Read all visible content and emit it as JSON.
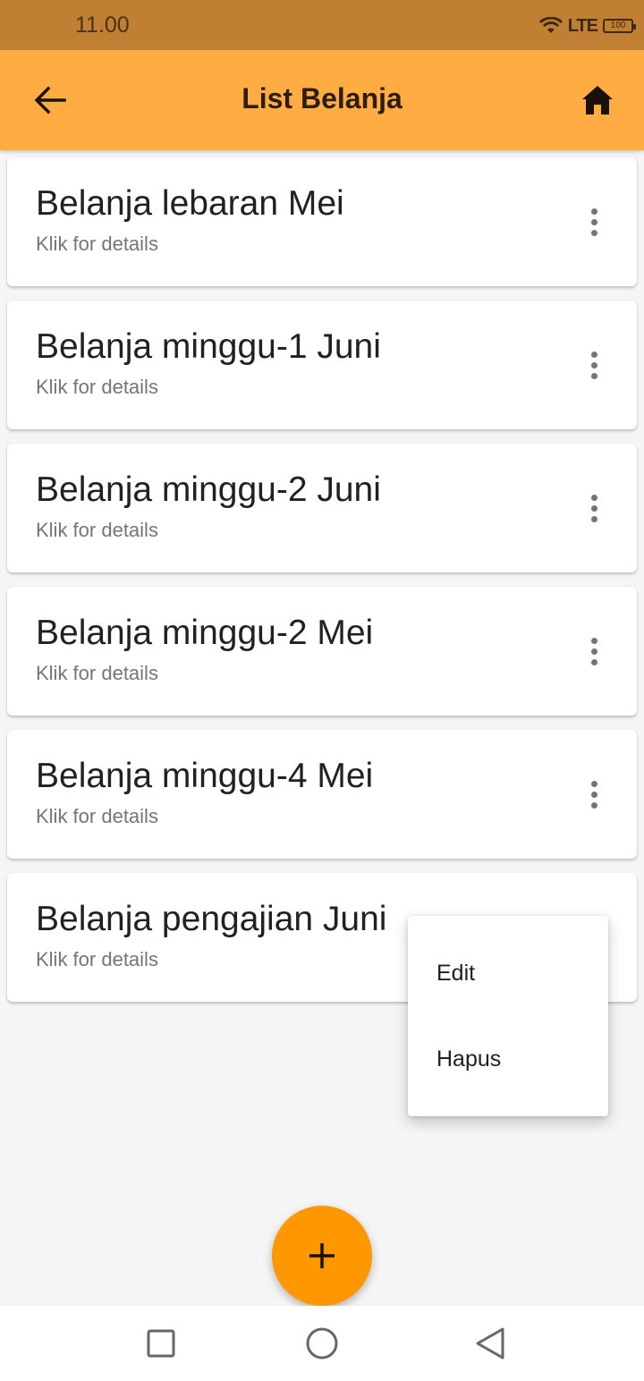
{
  "status_bar": {
    "time": "11.00",
    "network": "LTE",
    "battery": "100",
    "icons": [
      "wifi-icon",
      "lte-icon",
      "battery-icon"
    ]
  },
  "app_bar": {
    "title": "List Belanja",
    "back_icon": "arrow-left-icon",
    "home_icon": "home-icon",
    "color": "#ffad42"
  },
  "list": {
    "items": [
      {
        "title": "Belanja lebaran Mei",
        "subtitle": "Klik for details"
      },
      {
        "title": "Belanja minggu-1 Juni",
        "subtitle": "Klik for details"
      },
      {
        "title": "Belanja minggu-2 Juni",
        "subtitle": "Klik for details"
      },
      {
        "title": "Belanja minggu-2 Mei",
        "subtitle": "Klik for details"
      },
      {
        "title": "Belanja minggu-4 Mei",
        "subtitle": "Klik for details"
      },
      {
        "title": "Belanja pengajian Juni",
        "subtitle": "Klik for details"
      }
    ],
    "more_icon": "more-vertical-icon"
  },
  "popup_menu": {
    "items": [
      {
        "label": "Edit"
      },
      {
        "label": "Hapus"
      }
    ]
  },
  "fab": {
    "icon": "plus-icon",
    "color": "#ff9800"
  },
  "nav_bar": {
    "icons": [
      "recents-square-icon",
      "home-circle-icon",
      "back-triangle-icon"
    ]
  }
}
